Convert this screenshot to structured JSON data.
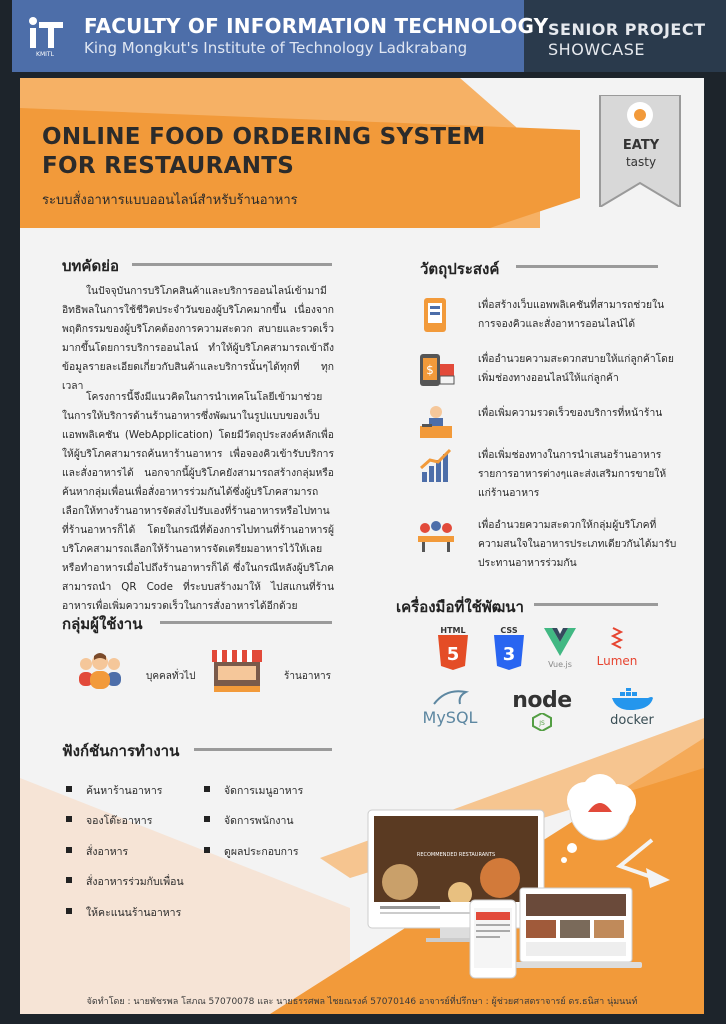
{
  "header": {
    "faculty": "FACULTY OF INFORMATION TECHNOLOGY",
    "institute": "King Mongkut's Institute of Technology Ladkrabang",
    "senior": "SENIOR PROJECT",
    "showcase": "SHOWCASE",
    "logo_text": "iT",
    "logo_sub": "KMITL"
  },
  "title": {
    "line1": "ONLINE FOOD ORDERING SYSTEM",
    "line2": "FOR RESTAURANTS",
    "thai": "ระบบสั่งอาหารแบบออนไลน์สำหรับร้านอาหาร"
  },
  "brand": {
    "name": "EATY",
    "tag": "tasty"
  },
  "abstract": {
    "heading": "บทคัดย่อ",
    "p1": "ในปัจจุบันการบริโภคสินค้าและบริการออนไลน์เข้ามามีอิทธิพลในการใช้ชีวิตประจำวันของผู้บริโภคมากขึ้น เนื่องจากพฤติกรรมของผู้บริโภคต้องการความสะดวก สบายและรวดเร็วมากขึ้นโดยการบริการออนไลน์ ทำให้ผู้บริโภคสามารถเข้าถึงข้อมูลรายละเอียดเกี่ยวกับสินค้าและบริการนั้นๆได้ทุกที่ ทุกเวลา",
    "p2": "โครงการนี้จึงมีแนวคิดในการนำเทคโนโลยีเข้ามาช่วยในการให้บริการด้านร้านอาหารซึ่งพัฒนาในรูปแบบของเว็บแอพพลิเคชัน (WebApplication) โดยมีวัตถุประสงค์หลักเพื่อให้ผู้บริโภคสามารถค้นหาร้านอาหาร เพื่อจองคิวเข้ารับบริการ และสั่งอาหารได้ นอกจากนี้ผู้บริโภคยังสามารถสร้างกลุ่มหรือค้นหากลุ่มเพื่อนเพื่อสั่งอาหารร่วมกันได้ซึ่งผู้บริโภคสามารถเลือกให้ทางร้านอาหารจัดส่งไปรับเองที่ร้านอาหารหรือไปทานที่ร้านอาหารก็ได้ โดยในกรณีที่ต้องการไปทานที่ร้านอาหารผู้บริโภคสามารถเลือกให้ร้านอาหารจัดเตรียมอาหารไว้ให้เลย หรือทำอาหารเมื่อไปถึงร้านอาหารก็ได้ ซึ่งในกรณีหลังผู้บริโภคสามารถนำ QR Code ที่ระบบสร้างมาให้ ไปสแกนที่ร้านอาหารเพื่อเพิ่มความรวดเร็วในการสั่งอาหารได้อีกด้วย"
  },
  "objectives": {
    "heading": "วัตถุประสงค์",
    "items": [
      {
        "icon": "phone-order-icon",
        "text": "เพื่อสร้างเว็บแอพพลิเคชันที่สามารถช่วยในการจองคิวและสั่งอาหารออนไลน์ได้"
      },
      {
        "icon": "mobile-shop-icon",
        "text": "เพื่ออำนวยความสะดวกสบายให้แก่ลูกค้าโดยเพิ่มช่องทางออนไลน์ให้แก่ลูกค้า"
      },
      {
        "icon": "service-counter-icon",
        "text": "เพื่อเพิ่มความรวดเร็วของบริการที่หน้าร้าน"
      },
      {
        "icon": "growth-chart-icon",
        "text": "เพื่อเพิ่มช่องทางในการนำเสนอร้านอาหารรายการอาหารต่างๆและส่งเสริมการขายให้แก่ร้านอาหาร"
      },
      {
        "icon": "group-dining-icon",
        "text": "เพื่ออำนวยความสะดวกให้กลุ่มผู้บริโภคที่ความสนใจในอาหารประเภทเดียวกันได้มารับประทานอาหารร่วมกัน"
      }
    ]
  },
  "users": {
    "heading": "กลุ่มผู้ใช้งาน",
    "people": "บุคคลทั่วไป",
    "restaurant": "ร้านอาหาร"
  },
  "functions": {
    "heading": "ฟังก์ชันการทำงาน",
    "col1": [
      "ค้นหาร้านอาหาร",
      "จองโต๊ะอาหาร",
      "สั่งอาหาร",
      "สั่งอาหารร่วมกับเพื่อน",
      "ให้คะแนนร้านอาหาร"
    ],
    "col2": [
      "จัดการเมนูอาหาร",
      "จัดการพนักงาน",
      "ดูผลประกอบการ"
    ]
  },
  "tools": {
    "heading": "เครื่องมือที่ใช้พัฒนา",
    "html": "HTML",
    "css": "CSS",
    "vue": "Vue.js",
    "lumen": "Lumen",
    "mysql": "MySQL",
    "node": "node",
    "docker": "docker"
  },
  "mockup": {
    "banner": "RECOMMENDED RESTAURANTS"
  },
  "credits": "จัดทำโดย : นายพัชรพล โสภณ 57070078 และ นายธรรศพล ไชยณรงค์ 57070146 อาจารย์ที่ปรึกษา : ผู้ช่วยศาสตราจารย์ ดร.ธนิสา นุ่มนนท์",
  "colors": {
    "orange": "#f29a3a",
    "blue": "#4d6ea9",
    "dark": "#1d242b"
  }
}
